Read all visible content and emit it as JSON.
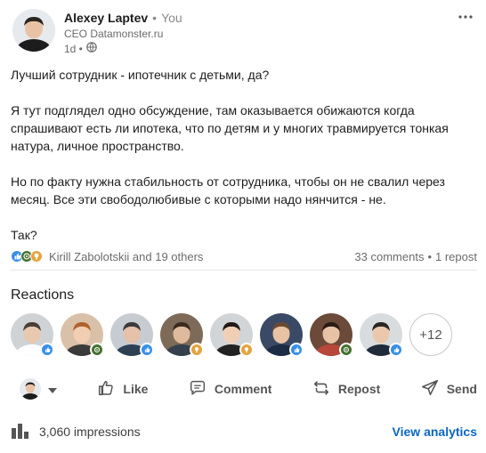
{
  "author": {
    "name": "Alexey Laptev",
    "separator": "•",
    "relation": "You",
    "title": "CEO Datamonster.ru",
    "time": "1d •"
  },
  "post": {
    "paragraphs": [
      "Лучший сотрудник - ипотечник с детьми, да?",
      "Я тут подглядел одно обсуждение, там оказывается обижаются когда спрашивают есть ли ипотека, что по детям и у многих травмируется тонкая натура, личное пространство.",
      "Но по факту нужна стабильность от сотрудника, чтобы он не свалил через месяц. Все эти свободолюбивые с которыми надо нянчится - не.",
      "Так?"
    ]
  },
  "social": {
    "likers": "Kirill Zabolotskii and 19 others",
    "comments": "33 comments",
    "dot": "•",
    "reposts": "1 repost"
  },
  "reactions": {
    "title": "Reactions",
    "more": "+12",
    "people": [
      {
        "bg": "#cfd3d6",
        "face": "#e8c9b0",
        "hair": "#4a3f38",
        "shirt": "#ffffff",
        "badge": "like"
      },
      {
        "bg": "#d9c0a8",
        "face": "#f1cdb2",
        "hair": "#b0622e",
        "shirt": "#3a3a3a",
        "badge": "celebrate"
      },
      {
        "bg": "#c6ccd2",
        "face": "#e4c1a8",
        "hair": "#3b3b3b",
        "shirt": "#2e4054",
        "badge": "like"
      },
      {
        "bg": "#7e6a58",
        "face": "#deb99c",
        "hair": "#3d2a1e",
        "shirt": "#35404d",
        "badge": "insightful"
      },
      {
        "bg": "#d2d5d8",
        "face": "#f0cfb6",
        "hair": "#1f1a17",
        "shirt": "#222222",
        "badge": "insightful"
      },
      {
        "bg": "#3a4a66",
        "face": "#e7c3a4",
        "hair": "#6b4a32",
        "shirt": "#1e2b45",
        "badge": "like"
      },
      {
        "bg": "#6b4a3a",
        "face": "#e8c2a5",
        "hair": "#2a1c14",
        "shirt": "#b8473a",
        "badge": "celebrate"
      },
      {
        "bg": "#d8dcdf",
        "face": "#ebc8ab",
        "hair": "#2a2623",
        "shirt": "#1f2a3a",
        "badge": "like"
      }
    ]
  },
  "actions": {
    "like": "Like",
    "comment": "Comment",
    "repost": "Repost",
    "send": "Send"
  },
  "footer": {
    "impressions": "3,060 impressions",
    "analytics": "View analytics"
  },
  "colors": {
    "like": "#378fe9",
    "celebrate": "#44712e",
    "insightful": "#e7a33e",
    "link": "#0a66c2"
  }
}
